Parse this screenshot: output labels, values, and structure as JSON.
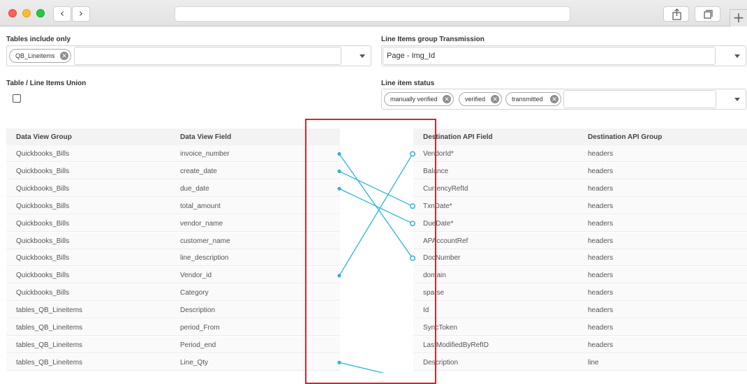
{
  "browser": {
    "back_icon": "‹",
    "forward_icon": "›",
    "share_icon": "share-icon",
    "tabs_icon": "tabs-icon",
    "plus_icon": "+"
  },
  "filters": {
    "tables_include": {
      "label": "Tables include only",
      "chips": [
        "QB_Lineitems"
      ]
    },
    "line_items_group": {
      "label": "Line Items group Transmission",
      "value": "Page - Img_Id"
    },
    "union": {
      "label": "Table / Line Items Union"
    },
    "line_item_status": {
      "label": "Line item status",
      "chips": [
        "manually verified",
        "verified",
        "transmitted"
      ]
    }
  },
  "left_table": {
    "headers": [
      "Data View Group",
      "Data View Field"
    ],
    "rows": [
      [
        "Quickbooks_Bills",
        "invoice_number"
      ],
      [
        "Quickbooks_Bills",
        "create_date"
      ],
      [
        "Quickbooks_Bills",
        "due_date"
      ],
      [
        "Quickbooks_Bills",
        "total_amount"
      ],
      [
        "Quickbooks_Bills",
        "vendor_name"
      ],
      [
        "Quickbooks_Bills",
        "customer_name"
      ],
      [
        "Quickbooks_Bills",
        "line_description"
      ],
      [
        "Quickbooks_Bills",
        "Vendor_id"
      ],
      [
        "Quickbooks_Bills",
        "Category"
      ],
      [
        "tables_QB_Lineitems",
        "Description"
      ],
      [
        "tables_QB_Lineitems",
        "period_From"
      ],
      [
        "tables_QB_Lineitems",
        "Period_end"
      ],
      [
        "tables_QB_Lineitems",
        "Line_Qty"
      ]
    ]
  },
  "right_table": {
    "headers": [
      "Destination API Field",
      "Destination API Group"
    ],
    "rows": [
      [
        "VendorId*",
        "headers"
      ],
      [
        "Balance",
        "headers"
      ],
      [
        "CurrencyRefId",
        "headers"
      ],
      [
        "TxnDate*",
        "headers"
      ],
      [
        "DueDate*",
        "headers"
      ],
      [
        "APAccountRef",
        "headers"
      ],
      [
        "DocNumber",
        "headers"
      ],
      [
        "domain",
        "headers"
      ],
      [
        "sparse",
        "headers"
      ],
      [
        "Id",
        "headers"
      ],
      [
        "SyncToken",
        "headers"
      ],
      [
        "LastModifiedByRefID",
        "headers"
      ],
      [
        "Description",
        "line"
      ]
    ]
  },
  "mappings": [
    {
      "from": 0,
      "to": 6
    },
    {
      "from": 1,
      "to": 3
    },
    {
      "from": 2,
      "to": 4
    },
    {
      "from": 7,
      "to": 0
    },
    {
      "from": 12,
      "to": 13
    }
  ],
  "colors": {
    "link": "#29b6d6",
    "highlight": "#d9232b"
  }
}
